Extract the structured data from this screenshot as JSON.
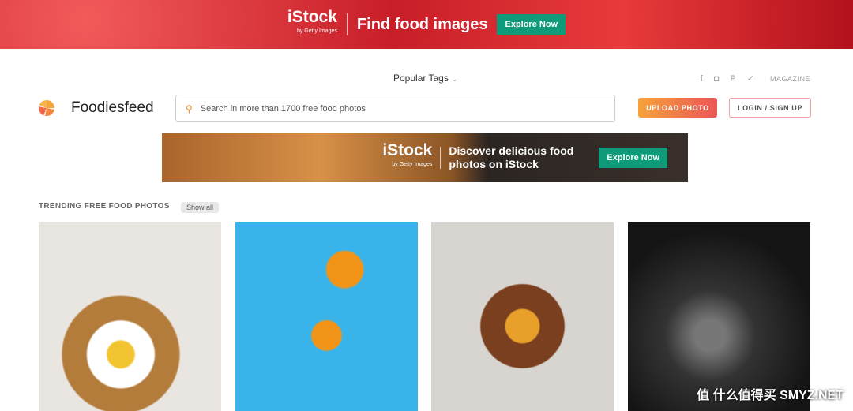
{
  "top_ad": {
    "brand": "iStock",
    "brand_sub": "by Getty Images",
    "headline": "Find food images",
    "cta": "Explore Now"
  },
  "header": {
    "popular_tags": "Popular Tags",
    "social": [
      {
        "icon": "facebook-icon",
        "glyph": "f"
      },
      {
        "icon": "instagram-icon",
        "glyph": "◘"
      },
      {
        "icon": "pinterest-icon",
        "glyph": "P"
      },
      {
        "icon": "twitter-icon",
        "glyph": "🐦"
      }
    ],
    "magazine": "MAGAZINE",
    "brand": "Foodiesfeed",
    "search_placeholder": "Search in more than 1700 free food photos",
    "upload": "UPLOAD PHOTO",
    "login": "LOGIN / SIGN UP"
  },
  "mid_ad": {
    "brand": "iStock",
    "brand_sub": "by Getty Images",
    "headline": "Discover delicious food photos on iStock",
    "cta": "Explore Now"
  },
  "trending": {
    "title": "TRENDING FREE FOOD PHOTOS",
    "show_all": "Show all"
  },
  "watermark": "值 什么值得买 SMYZ.NET"
}
